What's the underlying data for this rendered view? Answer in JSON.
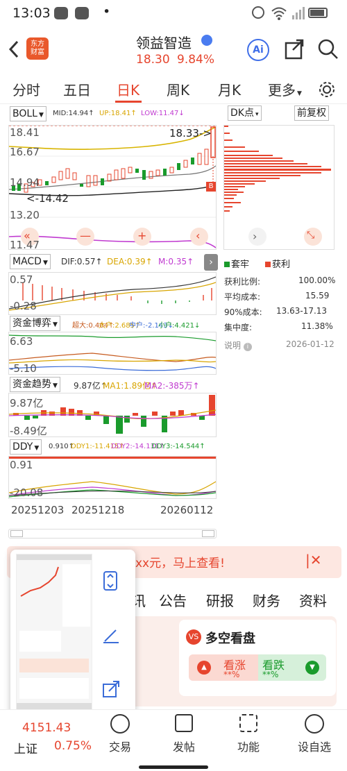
{
  "status": {
    "time": "13:03",
    "dot": "•"
  },
  "header": {
    "logo_text": "东方\n财富",
    "title": "领益智造",
    "price": "18.30",
    "change_pct": "9.84%",
    "ai_label": "Ai"
  },
  "tabs": [
    "分时",
    "五日",
    "日K",
    "周K",
    "月K",
    "更多"
  ],
  "active_tab": "日K",
  "boll": {
    "label": "BOLL",
    "mid": "MID:14.94↑",
    "up": "UP:18.41↑",
    "low": "LOW:11.47↓",
    "axis_top": "18.41",
    "axis_2": "16.67",
    "axis_3": "14.94",
    "axis_4": "13.20",
    "axis_bottom": "11.47",
    "high_marker": "18.33->",
    "low_marker": "<-14.42",
    "b_marker": "B"
  },
  "dk": {
    "label": "DK点",
    "fuquan": "前复权"
  },
  "chip": {
    "legend_trapped": "套牢",
    "legend_profit": "获利",
    "rows": [
      {
        "k": "获利比例:",
        "v": "100.00%"
      },
      {
        "k": "平均成本:",
        "v": "15.59"
      },
      {
        "k": "90%成本:",
        "v": "13.63-17.13"
      },
      {
        "k": "集中度:",
        "v": "11.38%"
      }
    ],
    "explain": "说明",
    "date": "2026-01-12"
  },
  "macd": {
    "label": "MACD",
    "dif": "DIF:0.57↑",
    "dea": "DEA:0.39↑",
    "m": "M:0.35↑",
    "axis_top": "0.57",
    "axis_bottom": "-0.28"
  },
  "fund_game": {
    "label": "资金博弈",
    "legend": [
      "超大:0.404↑",
      "大户:2.685↑",
      "中户:-2.143↓",
      "小户:4.421↓"
    ],
    "axis_top": "6.63",
    "axis_bottom": "-5.10"
  },
  "fund_trend": {
    "label": "资金趋势",
    "v": "9.87亿↑",
    "ma1": "MA1:1.89亿↑",
    "ma2": "MA2:-385万↑",
    "axis_top": "9.87亿",
    "axis_bottom": "-8.49亿"
  },
  "ddy": {
    "label": "DDY",
    "v": "0.910↑",
    "d1": "DDY1:-11.415↑",
    "d2": "DDY2:-14.131↑",
    "d3": "DDY3:-14.544↑",
    "axis_top": "0.91",
    "axis_bottom": "-20.08"
  },
  "dates": [
    "20251203",
    "20251218",
    "20260112"
  ],
  "banner": {
    "text": "xx元，马上查看!"
  },
  "news_tabs": [
    "讯",
    "公告",
    "研报",
    "财务",
    "资料"
  ],
  "duokong": {
    "title": "多空看盘",
    "up": "看涨",
    "down": "看跌",
    "up_val": "**%",
    "down_val": "**%"
  },
  "index": {
    "value": "4151.43",
    "name": "上证",
    "pct": "0.75%"
  },
  "bottom_nav": [
    "交易",
    "发帖",
    "功能",
    "设自选"
  ],
  "colors": {
    "up": "#e6452e",
    "down": "#1a9b2c",
    "accent": "#e6452e"
  }
}
